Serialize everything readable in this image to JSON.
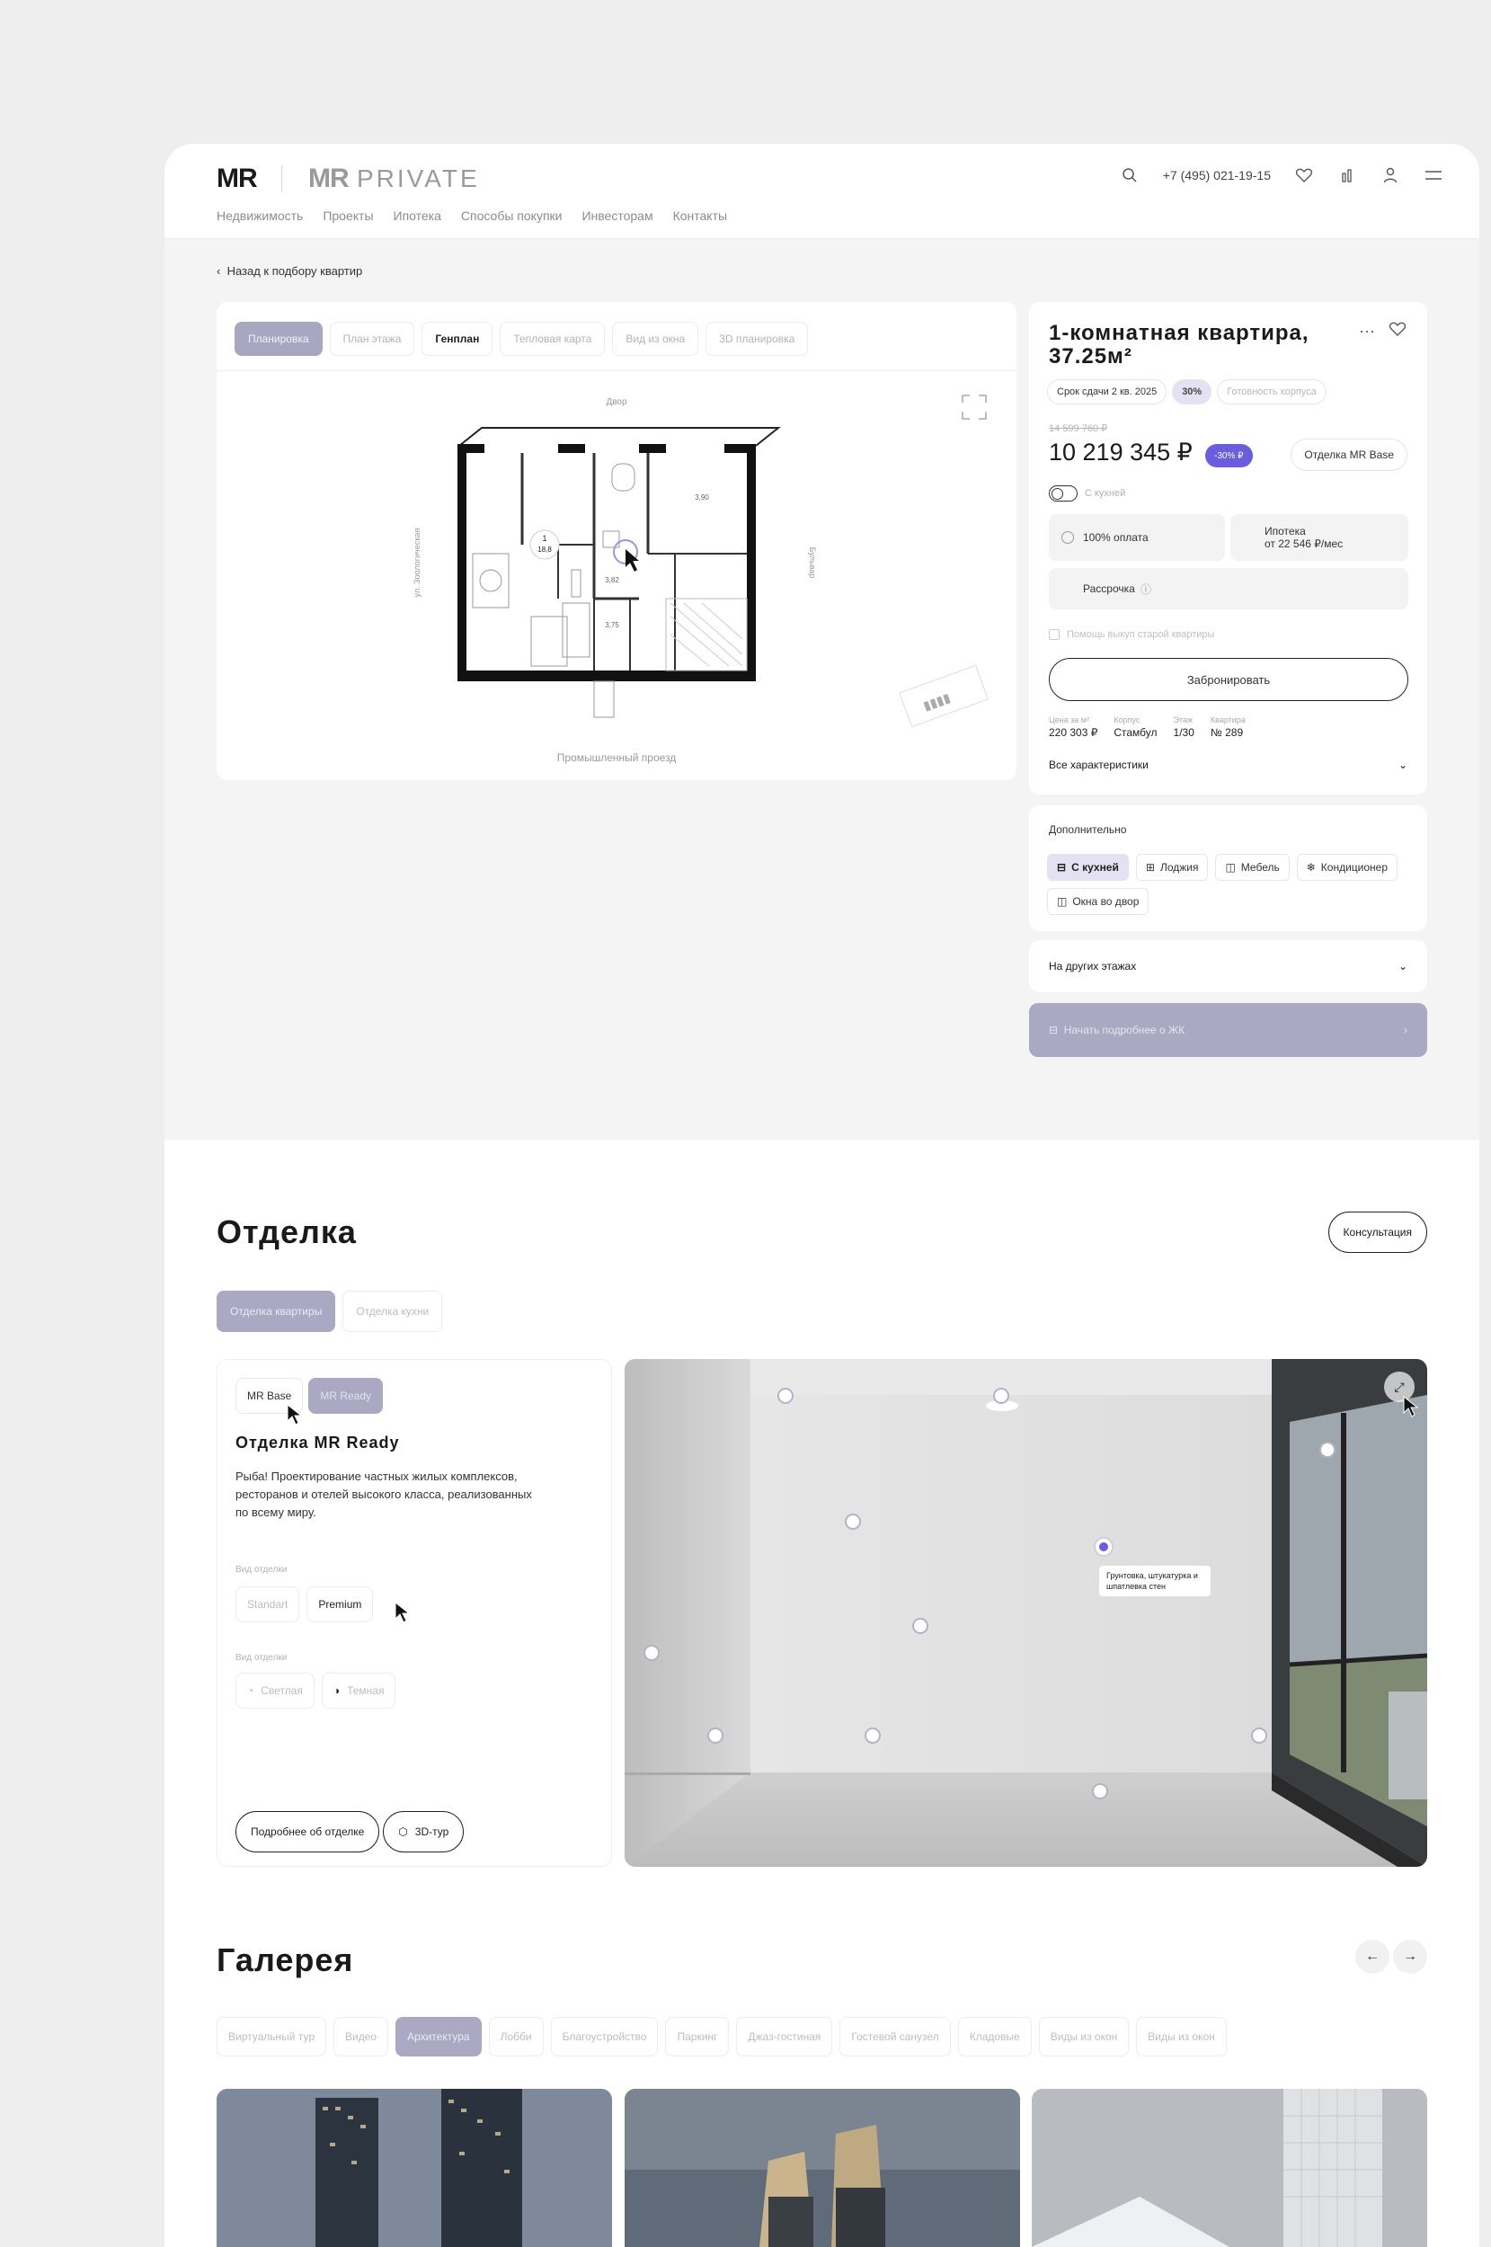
{
  "header": {
    "logo_mr": "MR",
    "logo_private_mr": "MR",
    "logo_private_word": "PRIVATE",
    "phone": "+7 (495) 021-19-15",
    "nav": [
      "Недвижимость",
      "Проекты",
      "Ипотека",
      "Способы покупки",
      "Инвесторам",
      "Контакты"
    ]
  },
  "back_link": "Назад к подбору квартир",
  "plan": {
    "tabs": [
      "Планировка",
      "План этажа",
      "Генплан",
      "Тепловая карта",
      "Вид из окна",
      "3D планировка"
    ],
    "active_tab": "Планировка",
    "room_number": "1",
    "room_area": "18,8",
    "dim_labels": [
      "3,90",
      "3,82",
      "3,75"
    ],
    "street_left": "ул. Зоологическая",
    "street_right": "Бульвар",
    "caption": "Промышленный проезд",
    "north_label": "Двор"
  },
  "apartment": {
    "title": "1-комнатная квартира, 37.25м²",
    "badges": [
      "Срок сдачи 2 кв. 2025",
      "30%",
      "Готовность корпуса"
    ],
    "old_price": "14 599 760 ₽",
    "price": "10 219 345 ₽",
    "discount": "-30% ₽",
    "finish": "Отделка MR Base",
    "toggle_label": "С кухней",
    "pay_full": "100% оплата",
    "mortgage_title": "Ипотека",
    "mortgage_value": "от 22 546 ₽/мес",
    "installment": "Рассрочка",
    "trade_in": "Помощь выкуп старой квартиры",
    "book_button": "Забронировать",
    "specs": [
      {
        "k": "Цена за м²",
        "v": "220 303 ₽"
      },
      {
        "k": "Корпус",
        "v": "Стамбул"
      },
      {
        "k": "Этаж",
        "v": "1/30"
      },
      {
        "k": "Квартира",
        "v": "№ 289"
      }
    ],
    "all_chars": "Все характеристики"
  },
  "extras": {
    "title": "Дополнительно",
    "tags": [
      {
        "label": "С кухней",
        "icon": "kitchen-icon",
        "on": true
      },
      {
        "label": "Лоджия",
        "icon": "loggia-icon",
        "on": false
      },
      {
        "label": "Мебель",
        "icon": "sofa-icon",
        "on": false
      },
      {
        "label": "Кондиционер",
        "icon": "ac-icon",
        "on": false
      },
      {
        "label": "Окна во двор",
        "icon": "window-icon",
        "on": false
      }
    ]
  },
  "other_floors": "На других этажах",
  "cta": "Начать подробнее о ЖК",
  "finishing": {
    "title": "Отделка",
    "consult_button": "Консультация",
    "tabs": [
      "Отделка квартиры",
      "Отделка кухни"
    ],
    "toggle": [
      "MR Base",
      "MR Ready"
    ],
    "name": "Отделка MR Ready",
    "description": "Рыба! Проектирование частных жилых комплексов, ресторанов и отелей высокого класса, реализованных по всему миру.",
    "type_label": "Вид отделки",
    "types": [
      "Standart",
      "Premium"
    ],
    "scheme_label": "Вид отделки",
    "schemes": [
      "Светлая",
      "Темная"
    ],
    "more_button": "Подробнее об отделке",
    "tour_button": "3D-тур",
    "tooltip": "Грунтовка, штукатурка и шпатлевка стен"
  },
  "gallery": {
    "title": "Галерея",
    "tabs": [
      "Виртуальный тур",
      "Видео",
      "Архитектура",
      "Лобби",
      "Благоустройство",
      "Паркинг",
      "Джаз-гостиная",
      "Гостевой санузел",
      "Кладовые",
      "Виды из окон",
      "Виды из окон"
    ],
    "active_tab": "Архитектура"
  },
  "colors": {
    "accent": "#6b5de0",
    "lavender": "#aaa8c2",
    "lavender_light": "#e4e2f2"
  }
}
